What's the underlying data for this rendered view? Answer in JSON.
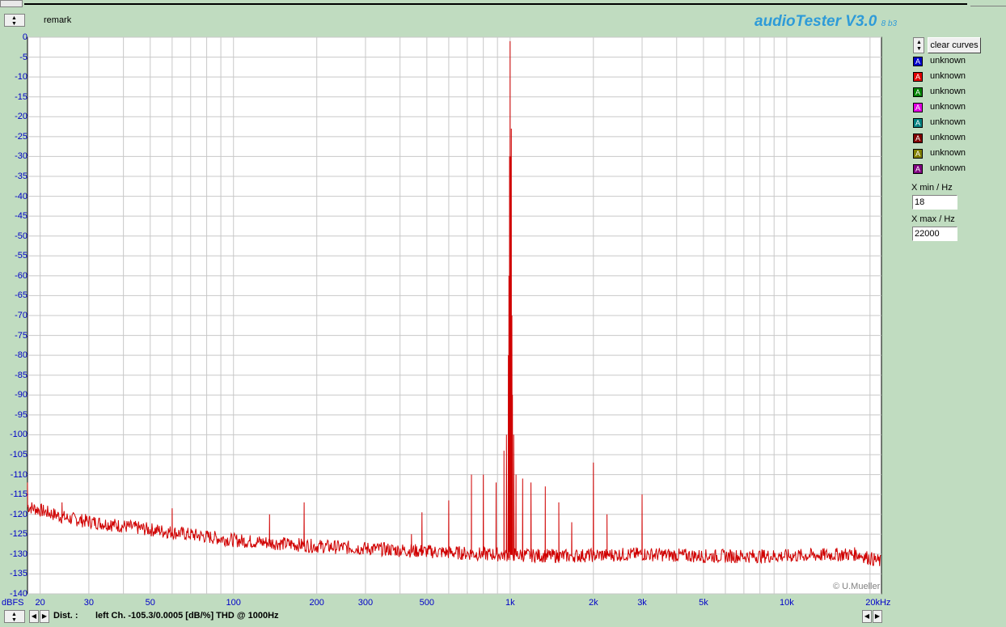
{
  "app": {
    "brand": "audioTester V3.0",
    "version_suffix": "8 b3",
    "remark_label": "remark",
    "copyright": "© U.Mueller"
  },
  "side_panel": {
    "clear_button": "clear curves",
    "curves": [
      {
        "label": "unknown",
        "color": "#0000c8"
      },
      {
        "label": "unknown",
        "color": "#e00000"
      },
      {
        "label": "unknown",
        "color": "#008000"
      },
      {
        "label": "unknown",
        "color": "#e000e0"
      },
      {
        "label": "unknown",
        "color": "#008080"
      },
      {
        "label": "unknown",
        "color": "#800000"
      },
      {
        "label": "unknown",
        "color": "#808000"
      },
      {
        "label": "unknown",
        "color": "#800080"
      }
    ],
    "xmin_label": "X min / Hz",
    "xmin_value": "18",
    "xmax_label": "X max / Hz",
    "xmax_value": "22000"
  },
  "status": {
    "dist_label": "Dist. :",
    "dist_text": "left Ch. -105.3/0.0005 [dB/%] THD @ 1000Hz"
  },
  "chart_data": {
    "type": "line",
    "ylabel": "dBFS",
    "xscale": "log",
    "xlim": [
      18,
      22000
    ],
    "ylim": [
      -140,
      0
    ],
    "grid": true,
    "y_ticks": [
      "0",
      "-5",
      "-10",
      "-15",
      "-20",
      "-25",
      "-30",
      "-35",
      "-40",
      "-45",
      "-50",
      "-55",
      "-60",
      "-65",
      "-70",
      "-75",
      "-80",
      "-85",
      "-90",
      "-95",
      "-100",
      "-105",
      "-110",
      "-115",
      "-120",
      "-125",
      "-130",
      "-135",
      "-140"
    ],
    "x_ticks": [
      {
        "v": 20,
        "label": "20"
      },
      {
        "v": 30,
        "label": "30"
      },
      {
        "v": 50,
        "label": "50"
      },
      {
        "v": 100,
        "label": "100"
      },
      {
        "v": 200,
        "label": "200"
      },
      {
        "v": 300,
        "label": "300"
      },
      {
        "v": 500,
        "label": "500"
      },
      {
        "v": 1000,
        "label": "1k"
      },
      {
        "v": 2000,
        "label": "2k"
      },
      {
        "v": 3000,
        "label": "3k"
      },
      {
        "v": 5000,
        "label": "5k"
      },
      {
        "v": 10000,
        "label": "10k"
      },
      {
        "v": 20000,
        "label": "20kHz"
      }
    ],
    "series": [
      {
        "color": "#d00000",
        "floor": [
          [
            18,
            -118
          ],
          [
            25,
            -121
          ],
          [
            40,
            -123
          ],
          [
            60,
            -124.5
          ],
          [
            100,
            -126.5
          ],
          [
            200,
            -128
          ],
          [
            400,
            -129
          ],
          [
            800,
            -130
          ],
          [
            1500,
            -130.5
          ],
          [
            3000,
            -130
          ],
          [
            5000,
            -130.5
          ],
          [
            10000,
            -130.5
          ],
          [
            18000,
            -130
          ],
          [
            22000,
            -132
          ]
        ],
        "peaks": [
          [
            18,
            -112
          ],
          [
            24,
            -117
          ],
          [
            36,
            -121.5
          ],
          [
            60,
            -118.5
          ],
          [
            135,
            -120
          ],
          [
            180,
            -117
          ],
          [
            440,
            -125
          ],
          [
            480,
            -119.5
          ],
          [
            600,
            -116.5
          ],
          [
            725,
            -110
          ],
          [
            800,
            -110
          ],
          [
            890,
            -112
          ],
          [
            950,
            -104
          ],
          [
            985,
            -80
          ],
          [
            1000,
            -1
          ],
          [
            1010,
            -23
          ],
          [
            1020,
            -90
          ],
          [
            1050,
            -110
          ],
          [
            1110,
            -111
          ],
          [
            1190,
            -112
          ],
          [
            1340,
            -113
          ],
          [
            1500,
            -117
          ],
          [
            1670,
            -122
          ],
          [
            2000,
            -107
          ],
          [
            2240,
            -120
          ],
          [
            3000,
            -115
          ]
        ]
      }
    ]
  }
}
